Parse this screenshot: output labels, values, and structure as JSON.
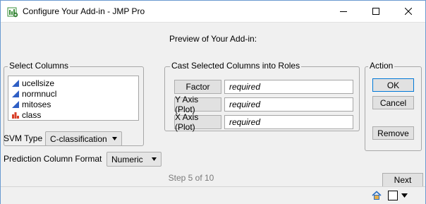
{
  "window": {
    "title": "Configure Your Add-in - JMP Pro",
    "app_icon": "jmp-addin-icon",
    "controls": [
      "minimize-icon",
      "maximize-icon",
      "close-icon"
    ]
  },
  "preview_label": "Preview of Your Add-in:",
  "select_columns": {
    "title": "Select Columns",
    "items": [
      {
        "label": "ucellsize",
        "icon": "continuous-column-icon"
      },
      {
        "label": "normnucl",
        "icon": "continuous-column-icon"
      },
      {
        "label": "mitoses",
        "icon": "continuous-column-icon"
      },
      {
        "label": "class",
        "icon": "nominal-column-icon"
      }
    ]
  },
  "svm_type": {
    "label": "SVM Type",
    "value": "C-classification"
  },
  "prediction_format": {
    "label": "Prediction Column Format",
    "value": "Numeric"
  },
  "cast_roles": {
    "title": "Cast Selected Columns into Roles",
    "roles": [
      {
        "button": "Factor",
        "value": "required"
      },
      {
        "button": "Y Axis (Plot)",
        "value": "required"
      },
      {
        "button": "X Axis (Plot)",
        "value": "required"
      }
    ]
  },
  "action": {
    "title": "Action",
    "ok": "OK",
    "cancel": "Cancel",
    "remove": "Remove"
  },
  "step_text": "Step 5 of 10",
  "next_label": "Next",
  "colors": {
    "continuous": "#2f5fc4",
    "nominal": "#d8402a",
    "focus_border": "#0078d7"
  }
}
